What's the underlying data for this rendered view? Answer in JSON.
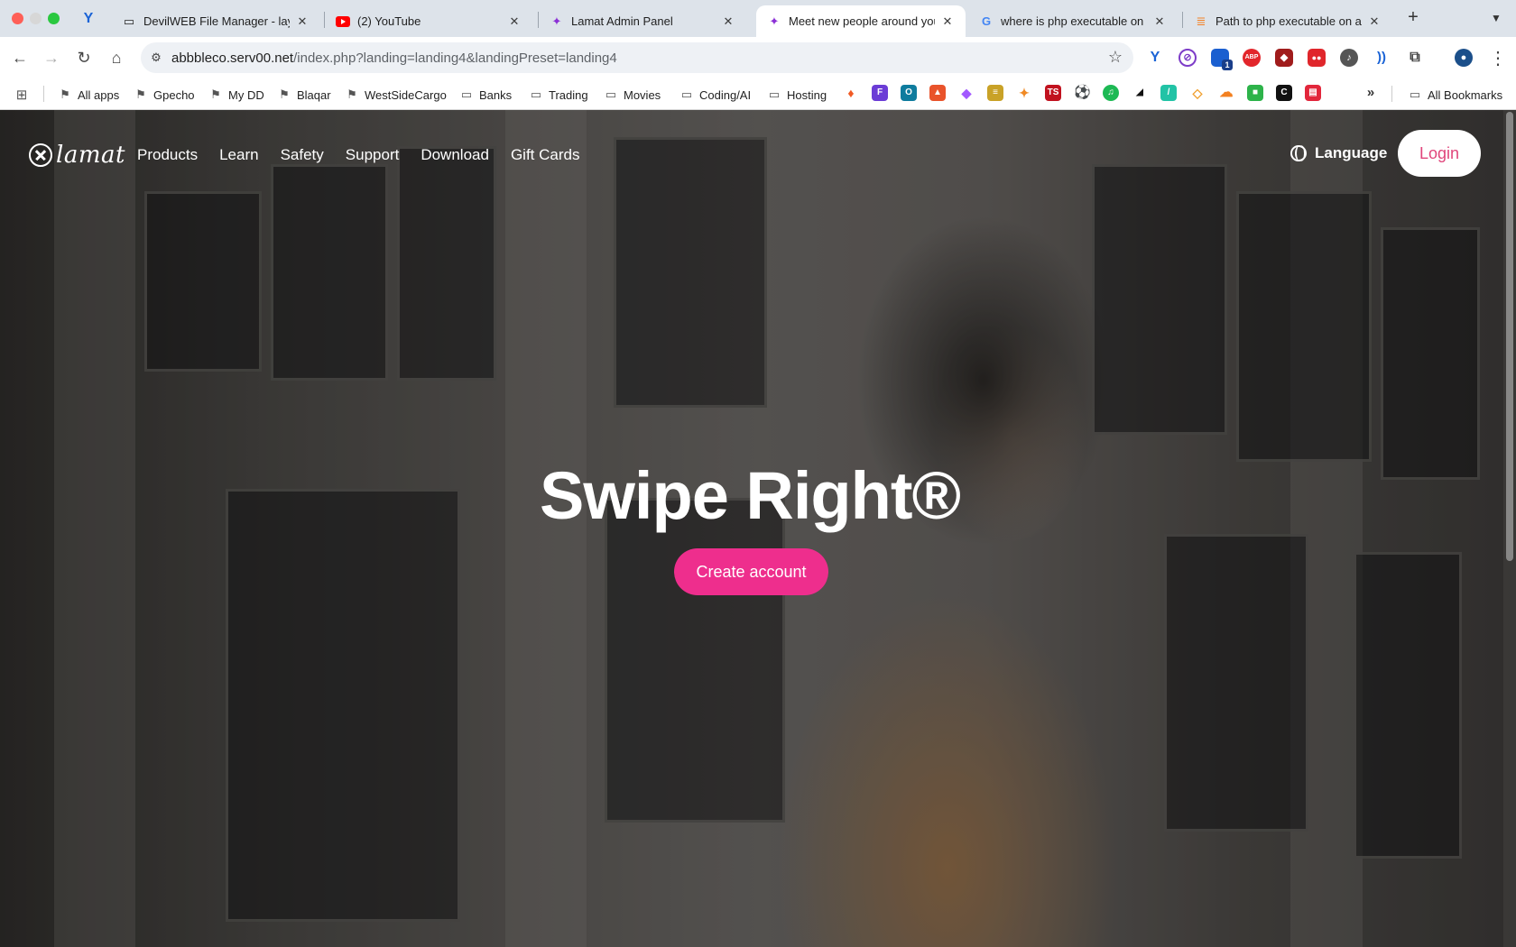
{
  "browser": {
    "tabs": [
      {
        "title": "DevilWEB File Manager - layo",
        "icon": "folder-icon",
        "active": false
      },
      {
        "title": "(2) YouTube",
        "icon": "youtube-icon",
        "active": false
      },
      {
        "title": "Lamat Admin Panel",
        "icon": "sparkle-icon",
        "active": false
      },
      {
        "title": "Meet new people around you",
        "icon": "sparkle-icon",
        "active": true
      },
      {
        "title": "where is php executable on m",
        "icon": "google-icon",
        "active": false
      },
      {
        "title": "Path to php executable on a m",
        "icon": "stackoverflow-icon",
        "active": false
      }
    ],
    "url_host": "abbbleco.serv00.net",
    "url_path": "/index.php?landing=landing4&landingPreset=landing4",
    "bookmarks": [
      "All apps",
      "Gpecho",
      "My DD",
      "Blaqar",
      "WestSideCargo",
      "Banks",
      "Trading",
      "Movies",
      "Coding/AI",
      "Hosting"
    ],
    "all_bookmarks": "All Bookmarks",
    "extension_badge": "1"
  },
  "site": {
    "logo_text": "lamat",
    "nav": [
      "Products",
      "Learn",
      "Safety",
      "Support",
      "Download",
      "Gift Cards"
    ],
    "language_label": "Language",
    "login_label": "Login",
    "hero_title": "Swipe Right®",
    "cta_label": "Create account",
    "accent_color": "#ee2e8d"
  }
}
